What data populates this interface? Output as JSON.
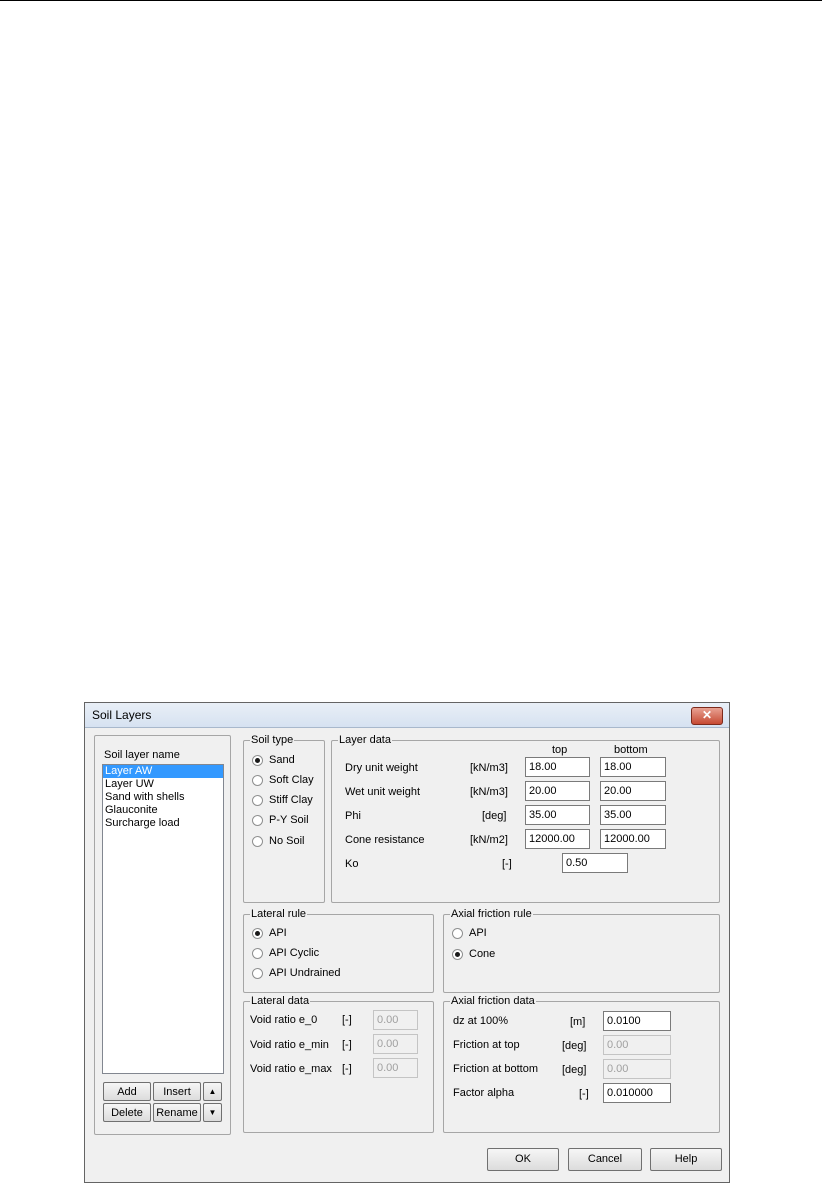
{
  "window": {
    "title": "Soil Layers",
    "close_label": "✕"
  },
  "soil_layers": {
    "label": "Soil layer name",
    "items": [
      "Layer AW",
      "Layer UW",
      "Sand with shells",
      "Glauconite",
      "Surcharge load"
    ],
    "selected": "Layer AW",
    "buttons": {
      "add": "Add",
      "insert": "Insert",
      "delete": "Delete",
      "rename": "Rename",
      "up": "▲",
      "down": "▼"
    }
  },
  "soil_type": {
    "label": "Soil type",
    "options": [
      "Sand",
      "Soft Clay",
      "Stiff Clay",
      "P-Y Soil",
      "No Soil"
    ],
    "selected": "Sand"
  },
  "layer_data": {
    "label": "Layer data",
    "col_top": "top",
    "col_bottom": "bottom",
    "rows": [
      {
        "name": "Dry unit weight",
        "unit": "[kN/m3]",
        "top": "18.00",
        "bottom": "18.00"
      },
      {
        "name": "Wet unit weight",
        "unit": "[kN/m3]",
        "top": "20.00",
        "bottom": "20.00"
      },
      {
        "name": "Phi",
        "unit": "[deg]",
        "top": "35.00",
        "bottom": "35.00"
      },
      {
        "name": "Cone resistance",
        "unit": "[kN/m2]",
        "top": "12000.00",
        "bottom": "12000.00"
      }
    ],
    "ko": {
      "name": "Ko",
      "unit": "[-]",
      "value": "0.50"
    }
  },
  "lateral_rule": {
    "label": "Lateral rule",
    "options": [
      "API",
      "API Cyclic",
      "API Undrained"
    ],
    "selected": "API"
  },
  "axial_friction_rule": {
    "label": "Axial friction rule",
    "options": [
      "API",
      "Cone"
    ],
    "selected": "Cone"
  },
  "lateral_data": {
    "label": "Lateral data",
    "rows": [
      {
        "name": "Void ratio e_0",
        "unit": "[-]",
        "value": "0.00"
      },
      {
        "name": "Void ratio e_min",
        "unit": "[-]",
        "value": "0.00"
      },
      {
        "name": "Void ratio e_max",
        "unit": "[-]",
        "value": "0.00"
      }
    ]
  },
  "axial_friction_data": {
    "label": "Axial friction data",
    "rows": [
      {
        "name": "dz at 100%",
        "unit": "[m]",
        "value": "0.0100"
      },
      {
        "name": "Friction at top",
        "unit": "[deg]",
        "value": "0.00"
      },
      {
        "name": "Friction at bottom",
        "unit": "[deg]",
        "value": "0.00"
      },
      {
        "name": "Factor alpha",
        "unit": "[-]",
        "value": "0.010000"
      }
    ]
  },
  "footer": {
    "ok": "OK",
    "cancel": "Cancel",
    "help": "Help"
  }
}
